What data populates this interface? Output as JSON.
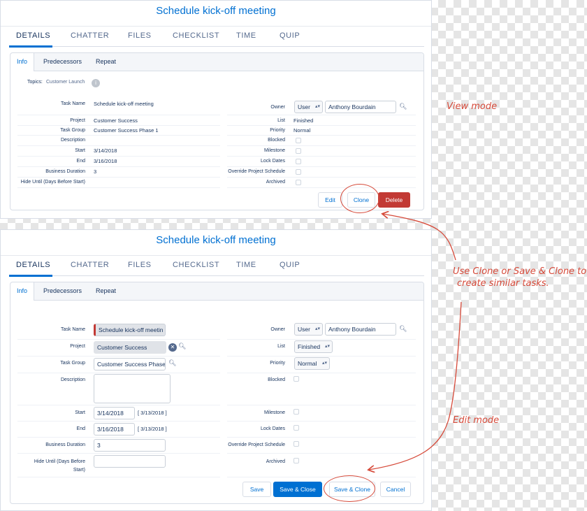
{
  "colors": {
    "brand_blue": "#0070d2",
    "delete_red": "#c23934",
    "annotation_red": "#d64a3a"
  },
  "view": {
    "title": "Schedule kick-off meeting",
    "tabs": [
      "DETAILS",
      "CHATTER",
      "FILES",
      "CHECKLIST",
      "TIME",
      "QUIP"
    ],
    "subtabs": [
      "Info",
      "Predecessors",
      "Repeat"
    ],
    "topics_label": "Topics:",
    "topics_value": "Customer Launch",
    "fields_left": [
      {
        "label": "Task Name",
        "value": "Schedule kick-off meeting"
      },
      {
        "label": "Project",
        "value": "Customer Success"
      },
      {
        "label": "Task Group",
        "value": "Customer Success Phase 1"
      },
      {
        "label": "Description",
        "value": ""
      },
      {
        "label": "Start",
        "value": "3/14/2018"
      },
      {
        "label": "End",
        "value": "3/16/2018"
      },
      {
        "label": "Business Duration",
        "value": "3"
      },
      {
        "label": "Hide Until (Days Before Start)",
        "value": ""
      }
    ],
    "owner_label": "Owner",
    "owner_type": "User",
    "owner_name": "Anthony Bourdain",
    "fields_right": [
      {
        "label": "List",
        "value": "Finished"
      },
      {
        "label": "Priority",
        "value": "Normal"
      },
      {
        "label": "Blocked",
        "value": ""
      },
      {
        "label": "Milestone",
        "value": ""
      },
      {
        "label": "Lock Dates",
        "value": ""
      },
      {
        "label": "Override Project Schedule",
        "value": ""
      },
      {
        "label": "Archived",
        "value": ""
      }
    ],
    "buttons": {
      "edit": "Edit",
      "clone": "Clone",
      "delete": "Delete"
    }
  },
  "edit": {
    "title": "Schedule kick-off meeting",
    "tabs": [
      "DETAILS",
      "CHATTER",
      "FILES",
      "CHECKLIST",
      "TIME",
      "QUIP"
    ],
    "subtabs": [
      "Info",
      "Predecessors",
      "Repeat"
    ],
    "labels": {
      "task_name": "Task Name",
      "project": "Project",
      "task_group": "Task Group",
      "description": "Description",
      "start": "Start",
      "end": "End",
      "business_duration": "Business Duration",
      "hide_until_1": "Hide Until (Days Before",
      "hide_until_2": "Start)",
      "owner": "Owner",
      "list": "List",
      "priority": "Priority",
      "blocked": "Blocked",
      "milestone": "Milestone",
      "lock_dates": "Lock Dates",
      "override": "Override Project Schedule",
      "archived": "Archived"
    },
    "values": {
      "task_name": "Schedule kick-off meetin",
      "project": "Customer Success",
      "task_group": "Customer Success Phase",
      "description": "",
      "start": "3/14/2018",
      "start_hint": "[ 3/13/2018 ]",
      "end": "3/16/2018",
      "end_hint": "[ 3/13/2018 ]",
      "business_duration": "3",
      "hide_until": "",
      "owner_type": "User",
      "owner_name": "Anthony Bourdain",
      "list": "Finished",
      "priority": "Normal"
    },
    "buttons": {
      "save": "Save",
      "save_close": "Save & Close",
      "save_clone": "Save & Clone",
      "cancel": "Cancel"
    }
  },
  "annotations": {
    "view_mode": "View mode",
    "use_clone_1": "Use Clone or Save & Clone to",
    "use_clone_2": "create similar tasks.",
    "edit_mode": "Edit mode"
  },
  "icons": {
    "info": "info-icon",
    "lookup": "magnifier-lookup-icon",
    "clear": "clear-x-icon",
    "select": "updown-caret-icon"
  }
}
